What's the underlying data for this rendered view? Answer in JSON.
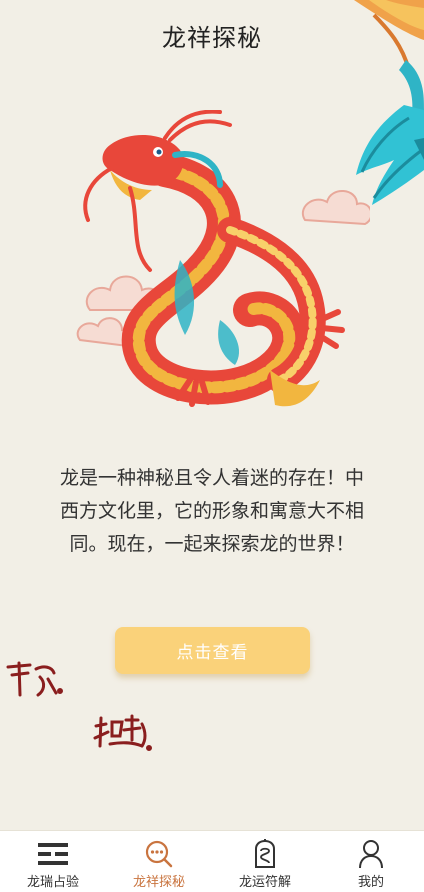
{
  "header": {
    "title": "龙祥探秘"
  },
  "main": {
    "intro_text": "龙是一种神秘且令人着迷的存在！中西方文化里，它的形象和寓意大不相同。现在，一起来探索龙的世界！",
    "cta_label": "点击查看"
  },
  "tabbar": {
    "items": [
      {
        "label": "龙瑞占验",
        "icon": "trigram-icon",
        "active": false
      },
      {
        "label": "龙祥探秘",
        "icon": "search-icon",
        "active": true
      },
      {
        "label": "龙运符解",
        "icon": "talisman-icon",
        "active": false
      },
      {
        "label": "我的",
        "icon": "user-icon",
        "active": false
      }
    ]
  },
  "colors": {
    "background": "#f2efe6",
    "accent": "#fad27a",
    "active_tab": "#c9743f",
    "dragon_red": "#e8473a",
    "dragon_gold": "#f2b63f",
    "dragon_teal": "#2fb4c6"
  }
}
